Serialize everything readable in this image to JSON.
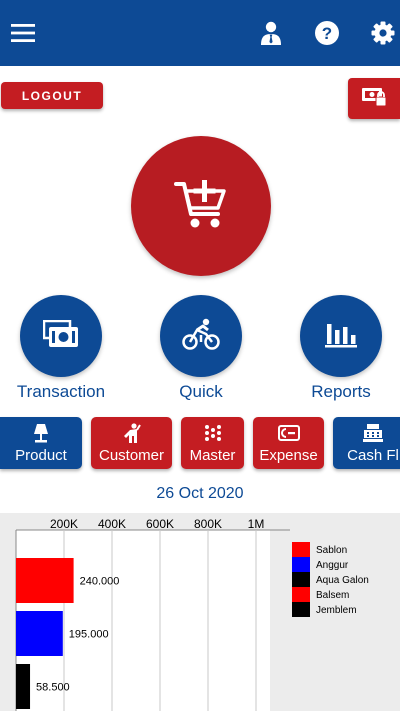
{
  "header": {
    "menu_icon": "hamburger-menu-icon",
    "profile_icon": "user-profile-icon",
    "help_icon": "help-circle-icon",
    "settings_icon": "gear-icon",
    "color": "#0d4a95"
  },
  "logout": {
    "label": "LOGOUT"
  },
  "lock_button": {
    "icon": "cash-register-lock-icon"
  },
  "cart_button": {
    "icon": "cart-add-icon"
  },
  "actions": [
    {
      "label": "Transaction",
      "icon": "money-icon"
    },
    {
      "label": "Quick",
      "icon": "cyclist-icon"
    },
    {
      "label": "Reports",
      "icon": "bar-chart-icon"
    }
  ],
  "tabs": [
    {
      "label": "Product",
      "icon": "lamp-icon",
      "color": "#0d4a95"
    },
    {
      "label": "Customer",
      "icon": "person-icon",
      "color": "#c41d22"
    },
    {
      "label": "Master",
      "icon": "dots-grid-icon",
      "color": "#c41d22"
    },
    {
      "label": "Expense",
      "icon": "wallet-icon",
      "color": "#c41d22"
    },
    {
      "label": "Cash Fl",
      "icon": "cash-register-icon",
      "color": "#0d4a95"
    }
  ],
  "date": "26 Oct 2020",
  "chart_data": {
    "type": "bar",
    "orientation": "horizontal",
    "x_tick_labels": [
      "200K",
      "400K",
      "600K",
      "800K",
      "1M"
    ],
    "xlim": [
      0,
      1000000
    ],
    "grid": true,
    "legend_position": "right",
    "bars": [
      {
        "name": "Sablon",
        "value": 240000,
        "label": "240.000",
        "color": "#ff0000"
      },
      {
        "name": "Anggur",
        "value": 195000,
        "label": "195.000",
        "color": "#0000ff"
      },
      {
        "name": "Aqua Galon",
        "value": 58500,
        "label": "58.500",
        "color": "#000000"
      }
    ],
    "legend": [
      {
        "name": "Sablon",
        "color": "#ff0000"
      },
      {
        "name": "Anggur",
        "color": "#0000ff"
      },
      {
        "name": "Aqua Galon",
        "color": "#000000"
      },
      {
        "name": "Balsem",
        "color": "#ff0000"
      },
      {
        "name": "Jemblem",
        "color": "#000000"
      }
    ]
  }
}
